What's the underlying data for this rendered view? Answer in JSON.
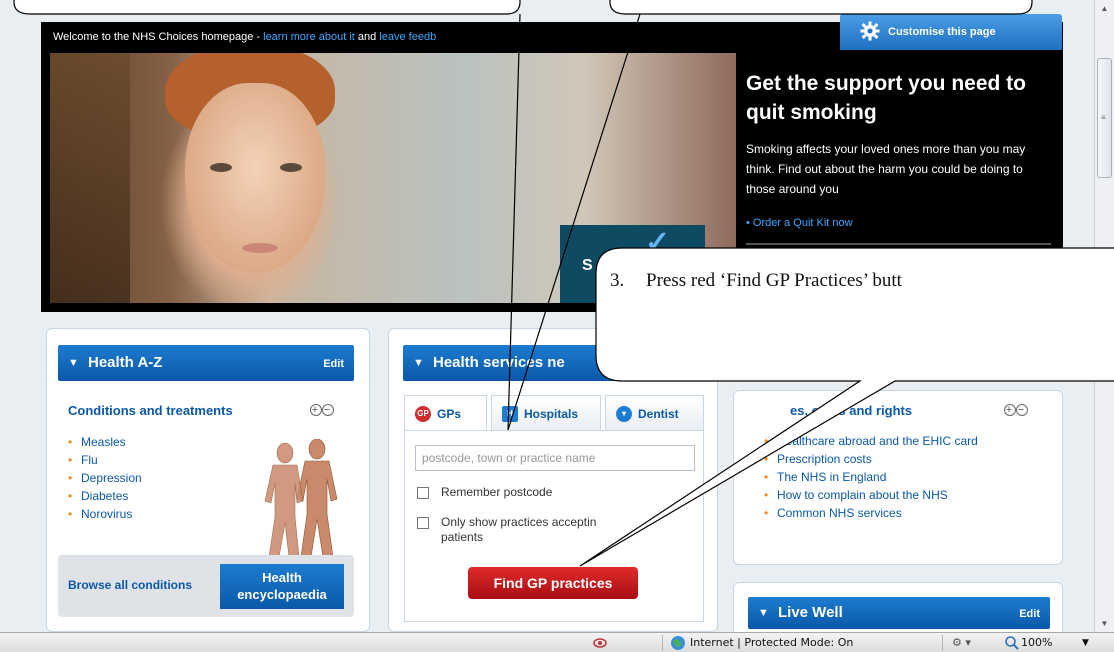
{
  "welcome": {
    "text": "Welcome to the NHS Choices homepage - ",
    "link1": "learn more about it",
    "mid": " and ",
    "link2": "leave feedb"
  },
  "customise_label": "Customise this page",
  "hero_promo": {
    "title": "Get the support you need to quit smoking",
    "body": "Smoking affects your loved ones more than you may think. Find out about the harm you could be doing to those around you",
    "link": "Order a Quit Kit now",
    "badge_text": "S"
  },
  "health_az": {
    "title": "Health A-Z",
    "edit": "Edit",
    "subtitle": "Conditions and treatments",
    "items": [
      "Measles",
      "Flu",
      "Depression",
      "Diabetes",
      "Norovirus"
    ],
    "browse_label": "Browse all conditions",
    "encyclopaedia_label": "Health encyclopaedia"
  },
  "health_services": {
    "title": "Health services ne",
    "tabs": [
      {
        "label": "GPs",
        "icon": "GP"
      },
      {
        "label": "Hospitals",
        "icon": "H"
      },
      {
        "label": "Dentist",
        "icon": "tooth"
      }
    ],
    "search_placeholder": "postcode, town or practice name",
    "remember_label": "Remember postcode",
    "only_show_label": "Only show practices acceptin patients",
    "find_button": "Find GP practices"
  },
  "rights_panel": {
    "subtitle": "es, costs and rights",
    "items": [
      "Healthcare abroad and the EHIC card",
      "Prescription costs",
      "The NHS in England",
      "How to complain about the NHS",
      "Common NHS services"
    ]
  },
  "live_well": {
    "title": "Live Well",
    "edit": "Edit"
  },
  "callout": {
    "number": "3.",
    "text": "Press red ‘Find GP Practices’ butt"
  },
  "statusbar": {
    "zone": "Internet | Protected Mode: On",
    "zoom": "100%"
  },
  "colors": {
    "nhs_blue": "#0b58a8",
    "find_button_red": "#c2141b",
    "bullet_orange": "#f08a24",
    "link_blue": "#3ea8ff"
  }
}
